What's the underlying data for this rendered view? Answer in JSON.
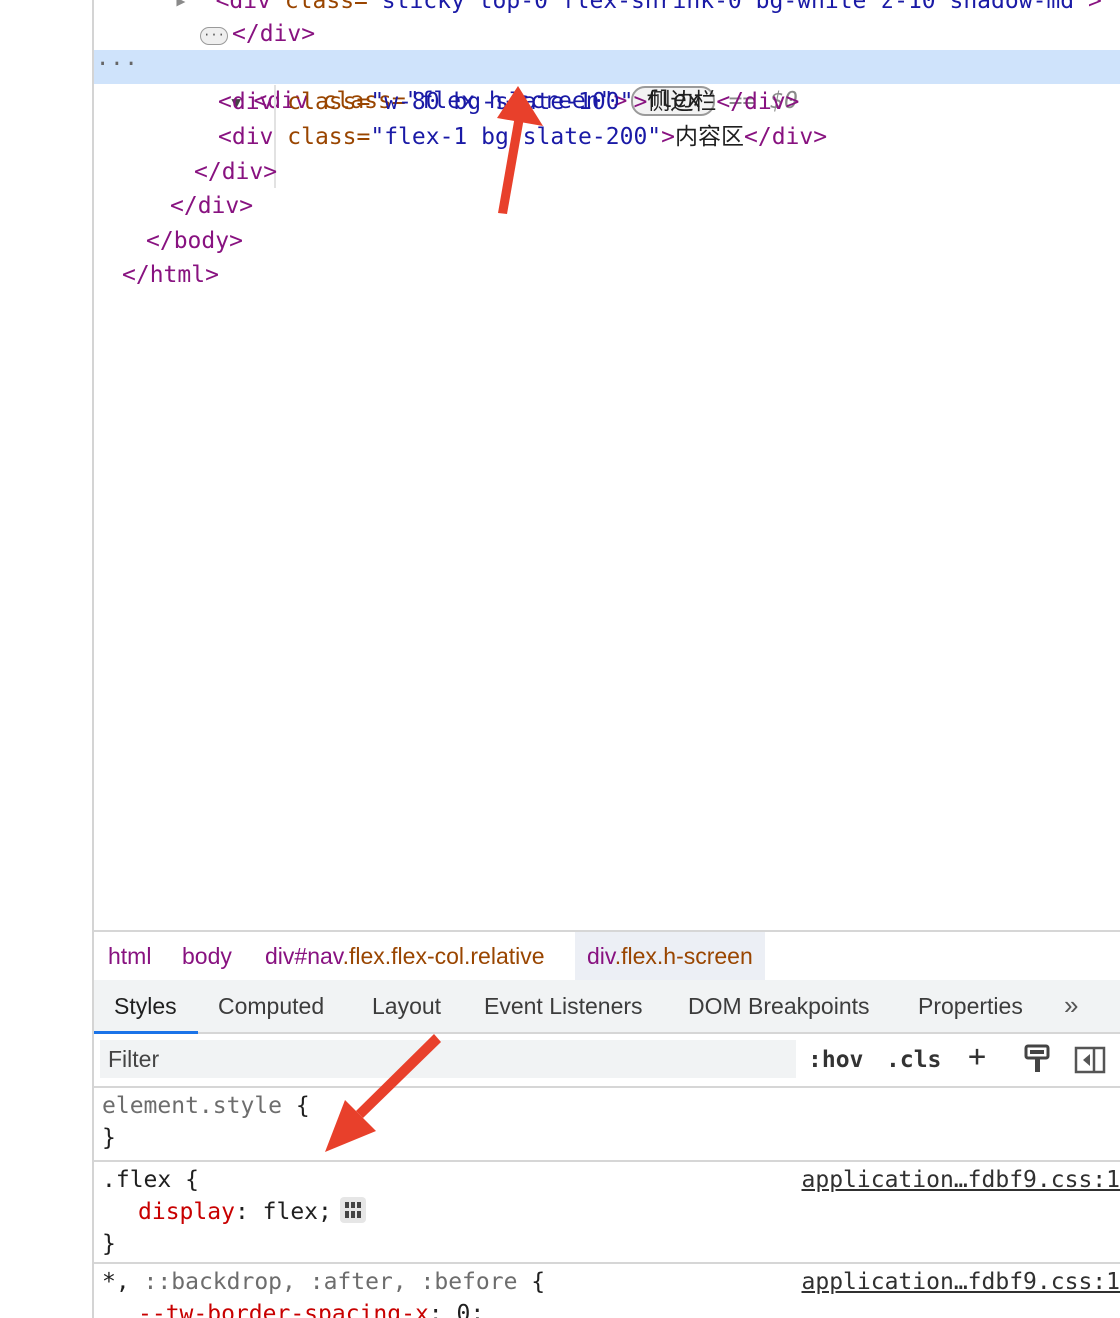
{
  "elements_tree": {
    "lines": [
      {
        "pre": "",
        "tag_open": "<div ",
        "attr": "class=",
        "val": "\"sticky top-0 flex-shrink-0 bg-white z-10 shadow-md\"",
        "tag_close": ">"
      },
      {
        "tag": "</div>"
      },
      {
        "tag_open": "<div ",
        "attr": "class=",
        "val": "\"flex h-screen\"",
        "tag_close": ">",
        "badge": "flex",
        "eq": "== ",
        "ref": "$0"
      },
      {
        "tag_open": "<div ",
        "attr": "class=",
        "val": "\"w-80 bg-slate-100\"",
        "tag_close": ">",
        "text": "侧边栏",
        "end": "</div>"
      },
      {
        "tag_open": "<div ",
        "attr": "class=",
        "val": "\"flex-1 bg-slate-200\"",
        "tag_close": ">",
        "text": "内容区",
        "end": "</div>"
      },
      {
        "tag": "</div>"
      },
      {
        "tag": "</div>"
      },
      {
        "tag": "</body>"
      },
      {
        "tag": "</html>"
      }
    ],
    "dots": "···",
    "ellipsis": "···"
  },
  "breadcrumbs": {
    "items": [
      {
        "tag": "html",
        "cls": ""
      },
      {
        "tag": "body",
        "cls": ""
      },
      {
        "tag": "div#nav",
        "cls": ".flex.flex-col.relative"
      },
      {
        "tag": "div",
        "cls": ".flex.h-screen"
      }
    ]
  },
  "tabs": {
    "items": [
      "Styles",
      "Computed",
      "Layout",
      "Event Listeners",
      "DOM Breakpoints",
      "Properties"
    ],
    "more": "»"
  },
  "filter": {
    "placeholder": "Filter",
    "hov": ":hov",
    "cls": ".cls",
    "plus": "+"
  },
  "styles_pane": {
    "element_style": {
      "selector": "element.style",
      "open": " {",
      "close": "}"
    },
    "flex_rule": {
      "selector": ".flex",
      "open": " {",
      "prop": "display",
      "colon": ": ",
      "value": "flex",
      "semi": ";",
      "close": "}",
      "source": "application…fdbf9.css:1"
    },
    "universal_rule": {
      "selector": "*,",
      "rest": " ::backdrop, :after, :before",
      "open": " {",
      "prop": "--tw-border-spacing-x",
      "colon": ": ",
      "value": "0",
      "semi": ";",
      "source": "application…fdbf9.css:1"
    }
  },
  "colors": {
    "arrow": "#e8402b",
    "selection": "#cfe3fb",
    "tab_accent": "#1a73e8"
  }
}
